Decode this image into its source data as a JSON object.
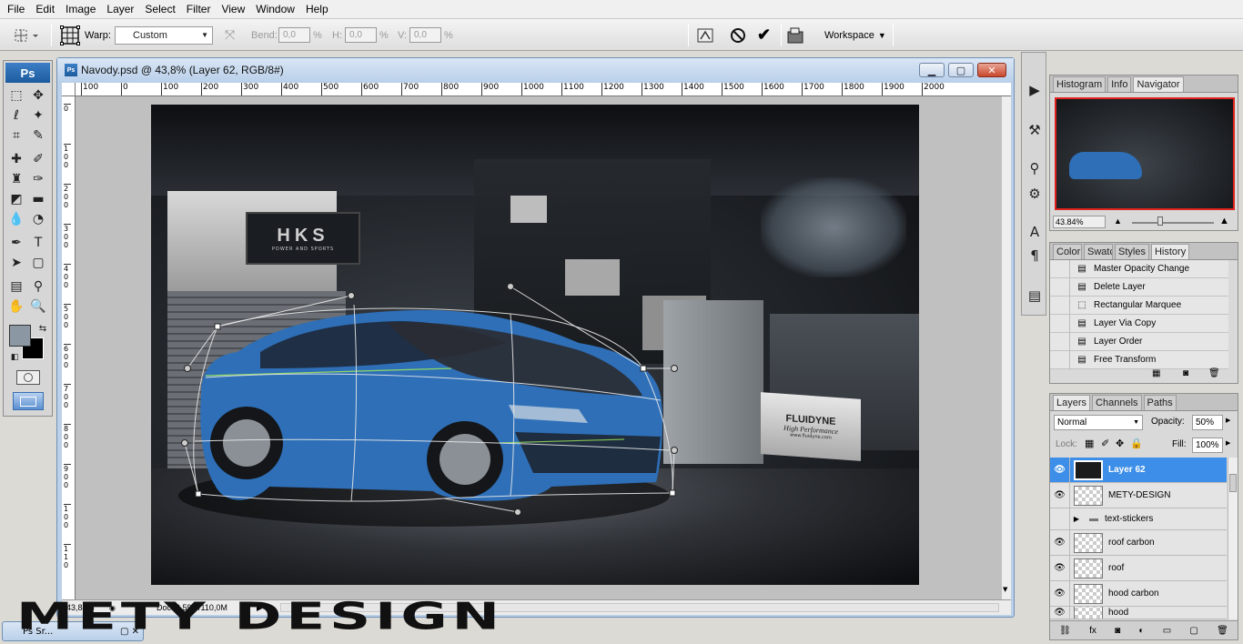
{
  "menu": [
    "File",
    "Edit",
    "Image",
    "Layer",
    "Select",
    "Filter",
    "View",
    "Window",
    "Help"
  ],
  "options": {
    "warp_label": "Warp:",
    "warp_value": "Custom",
    "bend_label": "Bend:",
    "bend_value": "0,0",
    "h_label": "H:",
    "h_value": "0,0",
    "v_label": "V:",
    "v_value": "0,0",
    "pct": "%",
    "workspace": "Workspace"
  },
  "tools": {
    "logo": "Ps"
  },
  "document": {
    "title": "Navody.psd @ 43,8% (Layer 62, RGB/8#)",
    "zoom": "43,84%",
    "doc_info": "Doc: 6,59M/110,0M",
    "ruler_h": [
      "100",
      "100",
      "0",
      "100",
      "200",
      "300",
      "400",
      "500",
      "600",
      "700",
      "800",
      "900",
      "1000",
      "1100",
      "1200",
      "1300",
      "1400",
      "1500",
      "1600",
      "1700",
      "1800",
      "1900",
      "2000"
    ],
    "ruler_v": [
      "0",
      "1 0 0",
      "2 0 0",
      "3 0 0",
      "4 0 0",
      "5 0 0",
      "6 0 0",
      "7 0 0",
      "8 0 0",
      "9 0 0",
      "1 0 0",
      "1 1 0"
    ]
  },
  "photo": {
    "sign_main": "HKS",
    "sign_sub": "POWER AND SPORTS",
    "box_brand": "FLUIDYNE",
    "box_slogan": "High Performance",
    "box_url": "www.fluidyne.com"
  },
  "navigator": {
    "tabs": [
      "Histogram",
      "Info",
      "Navigator"
    ],
    "zoom": "43.84%"
  },
  "history": {
    "tabs": [
      "Color",
      "Swatc",
      "Styles",
      "History"
    ],
    "items": [
      "Master Opacity Change",
      "Delete Layer",
      "Rectangular Marquee",
      "Layer Via Copy",
      "Layer Order",
      "Free Transform"
    ]
  },
  "layers": {
    "tabs": [
      "Layers",
      "Channels",
      "Paths"
    ],
    "blend_mode": "Normal",
    "opacity_label": "Opacity:",
    "opacity_value": "50%",
    "lock_label": "Lock:",
    "fill_label": "Fill:",
    "fill_value": "100%",
    "items": [
      "Layer 62",
      "METY-DESIGN",
      "text-stickers",
      "roof carbon",
      "roof",
      "hood carbon",
      "hood"
    ]
  },
  "taskbar": {
    "mini_doc": "Ps Sr..."
  },
  "watermark": "METY DESIGN",
  "colors": {
    "accent": "#3c8ee8",
    "brand_blue": "#1c5b9e",
    "car_blue": "#2e6fb8"
  }
}
